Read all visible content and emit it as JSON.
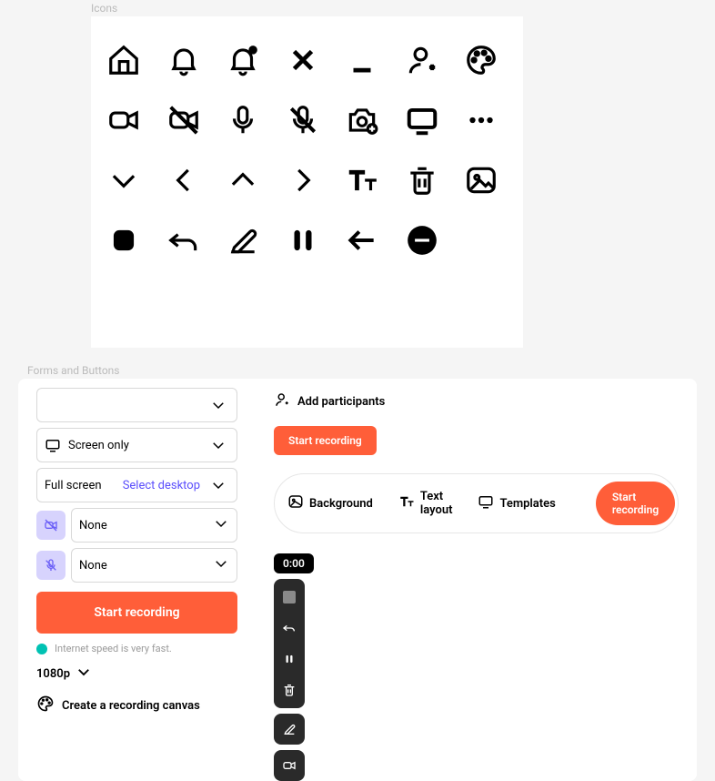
{
  "sections": {
    "icons": "Icons",
    "forms": "Forms and Buttons"
  },
  "icons_grid": [
    "home-icon",
    "bell-icon",
    "bell-badge-icon",
    "close-icon",
    "minimize-icon",
    "user-plus-icon",
    "palette-icon",
    "video-icon",
    "video-off-icon",
    "mic-icon",
    "mic-off-icon",
    "camera-plus-icon",
    "monitor-icon",
    "more-icon",
    "chevron-down-icon",
    "chevron-left-icon",
    "chevron-up-icon",
    "chevron-right-icon",
    "text-layout-icon",
    "trash-icon",
    "image-icon",
    "stop-icon",
    "undo-icon",
    "edit-icon",
    "pause-icon",
    "arrow-left-icon",
    "remove-icon"
  ],
  "forms": {
    "emptySelect": "",
    "screenOnly": "Screen only",
    "fullScreen": {
      "label": "Full screen",
      "action": "Select desktop"
    },
    "camera": {
      "value": "None"
    },
    "mic": {
      "value": "None"
    },
    "startButton": "Start recording",
    "status": "Internet speed is very fast.",
    "quality": "1080p",
    "createCanvas": "Create a recording canvas"
  },
  "right": {
    "addParticipants": "Add participants",
    "startSmall": "Start recording",
    "seg": {
      "background": "Background",
      "textLayout": "Text layout",
      "templates": "Templates",
      "start": "Start recording"
    },
    "timer": "0:00"
  }
}
